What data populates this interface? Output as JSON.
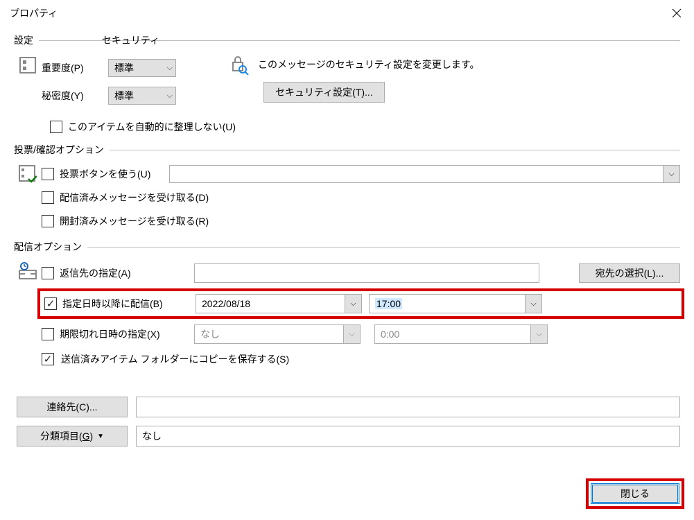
{
  "window": {
    "title": "プロパティ"
  },
  "settings": {
    "legend": "設定",
    "security_legend": "セキュリティ",
    "importance_label": "重要度(P)",
    "importance_value": "標準",
    "sensitivity_label": "秘密度(Y)",
    "sensitivity_value": "標準",
    "security_desc": "このメッセージのセキュリティ設定を変更します。",
    "security_button": "セキュリティ設定(T)...",
    "auto_archive_label": "このアイテムを自動的に整理しない(U)"
  },
  "voting": {
    "legend": "投票/確認オプション",
    "use_voting_buttons": "投票ボタンを使う(U)",
    "delivery_receipt": "配信済みメッセージを受け取る(D)",
    "read_receipt": "開封済みメッセージを受け取る(R)"
  },
  "delivery": {
    "legend": "配信オプション",
    "reply_to_label": "返信先の指定(A)",
    "recipients_button": "宛先の選択(L)...",
    "delay_label": "指定日時以降に配信(B)",
    "delay_date": "2022/08/18",
    "delay_time": "17:00",
    "expire_label": "期限切れ日時の指定(X)",
    "expire_date": "なし",
    "expire_time": "0:00",
    "save_sent_label": "送信済みアイテム フォルダーにコピーを保存する(S)"
  },
  "bottom": {
    "contacts_button": "連絡先(C)...",
    "categories_button_prefix": "分類項目(",
    "categories_hotkey": "G",
    "categories_button_suffix": ")",
    "categories_value": "なし"
  },
  "footer": {
    "close": "閉じる"
  }
}
